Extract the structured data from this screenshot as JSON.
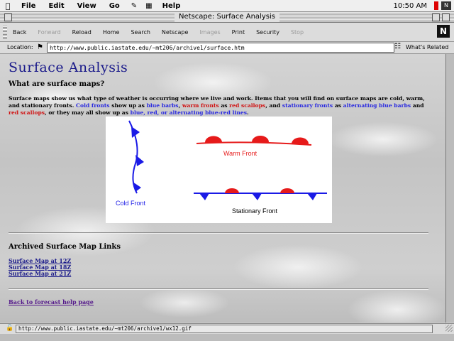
{
  "menubar": {
    "apple": "",
    "items": [
      "File",
      "Edit",
      "View",
      "Go",
      "Help"
    ],
    "clock": "10:50 AM"
  },
  "window": {
    "title": "Netscape: Surface Analysis"
  },
  "toolbar": {
    "buttons": [
      {
        "label": "Back",
        "enabled": true
      },
      {
        "label": "Forward",
        "enabled": false
      },
      {
        "label": "Reload",
        "enabled": true
      },
      {
        "label": "Home",
        "enabled": true
      },
      {
        "label": "Search",
        "enabled": true
      },
      {
        "label": "Netscape",
        "enabled": true
      },
      {
        "label": "Images",
        "enabled": false
      },
      {
        "label": "Print",
        "enabled": true
      },
      {
        "label": "Security",
        "enabled": true
      },
      {
        "label": "Stop",
        "enabled": false
      }
    ]
  },
  "location": {
    "label": "Location:",
    "url": "http://www.public.iastate.edu/~mt206/archive1/surface.htm",
    "related": "What's Related"
  },
  "page": {
    "title": "Surface Analysis",
    "question": "What are surface maps?",
    "intro": {
      "p1": "Surface maps show us what type of weather is occurring where we live and work.  Items that you will find on surface maps are cold, warm, and stationary fronts.  ",
      "cold": "Cold fronts",
      "p2": " show up as ",
      "blue_barbs": "blue barbs",
      "p3": ", ",
      "warm": "warm fronts",
      "p4": " as ",
      "red_scallops": "red scallops",
      "p5": ", and ",
      "stationary": "stationary fronts",
      "p6": " as ",
      "alt1": "alternating blue barbs",
      "p7": " and ",
      "alt2": "red scallops",
      "p8": ", or they may all show up as ",
      "blue_red": "blue, red, or alternating blue-red lines",
      "p9": "."
    },
    "fronts_image": {
      "warm_label": "Warm Front",
      "cold_label": "Cold Front",
      "stationary_label": "Stationary Front",
      "colors": {
        "cold": "#1a1ae6",
        "warm": "#e61a1a"
      }
    },
    "archive_heading": "Archived Surface Map Links",
    "archive_links": [
      "Surface Map at 12Z",
      "Surface Map at 18Z",
      "Surface Map at 21Z"
    ],
    "back_link": "Back to forecast help page"
  },
  "status": {
    "text": "http://www.public.iastate.edu/~mt206/archive1/wx12.gif"
  }
}
